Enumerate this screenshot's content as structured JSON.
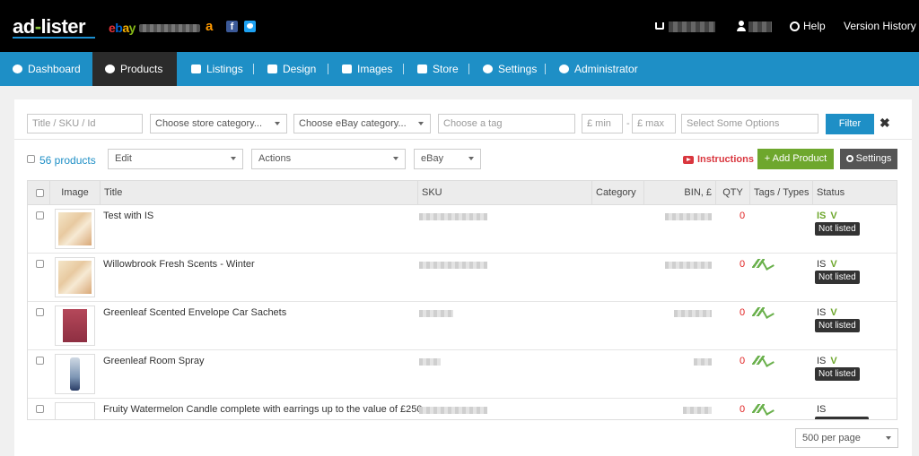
{
  "app": {
    "logo": {
      "ad": "ad",
      "dash": "-",
      "lister": "lister"
    },
    "ebay_logo": {
      "e": "e",
      "b": "b",
      "a": "a",
      "y": "y"
    },
    "amazon_glyph": "a",
    "facebook_glyph": "f"
  },
  "topbar": {
    "help_label": "Help",
    "version_history_label": "Version History"
  },
  "nav": {
    "items": [
      {
        "label": "Dashboard",
        "icon": "dashboard-icon"
      },
      {
        "label": "Products",
        "icon": "products-icon",
        "active": true
      },
      {
        "label": "Listings",
        "icon": "listings-icon"
      },
      {
        "label": "Design",
        "icon": "design-icon"
      },
      {
        "label": "Images",
        "icon": "images-icon"
      },
      {
        "label": "Store",
        "icon": "store-icon"
      },
      {
        "label": "Settings",
        "icon": "gear-icon"
      },
      {
        "label": "Administrator",
        "icon": "admin-icon"
      }
    ]
  },
  "filters": {
    "title_placeholder": "Title / SKU / Id",
    "store_category": "Choose store category...",
    "ebay_category": "Choose eBay category...",
    "tag_placeholder": "Choose a tag",
    "min_placeholder": "£ min",
    "dash": "-",
    "max_placeholder": "£ max",
    "options_placeholder": "Select Some Options",
    "filter_label": "Filter",
    "close_glyph": "✖"
  },
  "actions": {
    "count_label": "56 products",
    "edit_label": "Edit",
    "actions_label": "Actions",
    "marketplace_label": "eBay",
    "instructions_label": "Instructions",
    "add_product_label": "+ Add Product",
    "settings_label": "Settings"
  },
  "table": {
    "headers": {
      "image": "Image",
      "title": "Title",
      "sku": "SKU",
      "category": "Category",
      "bin": "BIN, £",
      "qty": "QTY",
      "tags": "Tags / Types",
      "status": "Status"
    },
    "rows": [
      {
        "title": "Test with IS",
        "qty": "0",
        "status": "IS",
        "status_v": "V",
        "badge": "Not listed",
        "thumb": "floral-thumbnail",
        "has_tag": false,
        "is_green": true
      },
      {
        "title": "Willowbrook Fresh Scents - Winter",
        "qty": "0",
        "status": "IS",
        "status_v": "V",
        "badge": "Not listed",
        "thumb": "floral-thumbnail",
        "has_tag": true,
        "is_green": false
      },
      {
        "title": "Greenleaf Scented Envelope Car Sachets",
        "qty": "0",
        "status": "IS",
        "status_v": "V",
        "badge": "Not listed",
        "thumb": "sachet-thumbnail",
        "has_tag": true,
        "is_green": false
      },
      {
        "title": "Greenleaf Room Spray",
        "qty": "0",
        "status": "IS",
        "status_v": "V",
        "badge": "Not listed",
        "thumb": "spray-thumbnail",
        "has_tag": true,
        "is_green": false
      },
      {
        "title": "Fruity Watermelon Candle complete with earrings up to the value of £250",
        "qty": "0",
        "status": "IS",
        "status_v": "",
        "badge": "",
        "thumb": "candle-thumbnail",
        "has_tag": true,
        "is_green": false
      }
    ]
  },
  "pagination": {
    "per_page_label": "500 per page"
  }
}
